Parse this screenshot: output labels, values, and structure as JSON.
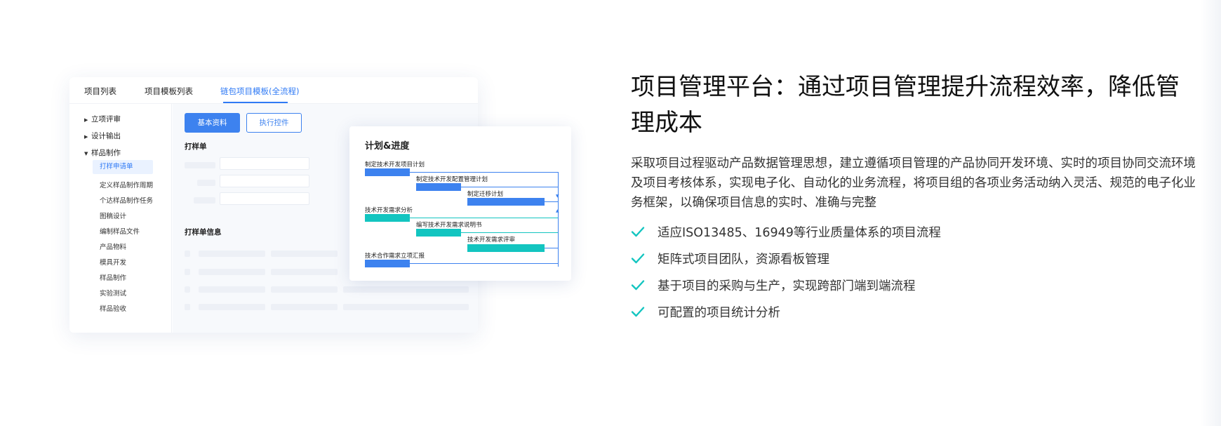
{
  "mock": {
    "tabs": [
      "项目列表",
      "项目模板列表",
      "链包项目模板(全流程)"
    ],
    "sidebar": {
      "groups": [
        "立项评审",
        "设计输出",
        "样品制作"
      ],
      "subitems": [
        "打样申请单",
        "定义样品制作周期",
        "个达样品制作任务",
        "图稿设计",
        "编制样品文件",
        "产品物料",
        "模具开发",
        "样品制作",
        "实验测试",
        "样品验收"
      ],
      "active_subitem": "打样申请单"
    },
    "buttons": {
      "primary": "基本资料",
      "secondary": "执行控件"
    },
    "sections": [
      "打样单",
      "打样单信息"
    ]
  },
  "gantt": {
    "title": "计划&进度",
    "tasks": [
      "制定技术开发项目计划",
      "制定技术开发配置管理计划",
      "制定迁移计划",
      "技术开发需求分析",
      "编写技术开发需求说明书",
      "技术开发需求评审",
      "技术合作需求立项汇报"
    ]
  },
  "colors": {
    "accent": "#3d82ef",
    "teal": "#13c5c0",
    "check": "#13c5c0"
  },
  "hero": {
    "headline": "项目管理平台：通过项目管理提升流程效率，降低管理成本",
    "description": "采取项目过程驱动产品数据管理思想，建立遵循项目管理的产品协同开发环境、实时的项目协同交流环境及项目考核体系，实现电子化、自动化的业务流程，将项目组的各项业务活动纳入灵活、规范的电子化业务框架，以确保项目信息的实时、准确与完整",
    "features": [
      "适应ISO13485、16949等行业质量体系的项目流程",
      "矩阵式项目团队，资源看板管理",
      "基于项目的采购与生产，实现跨部门端到端流程",
      "可配置的项目统计分析"
    ]
  }
}
